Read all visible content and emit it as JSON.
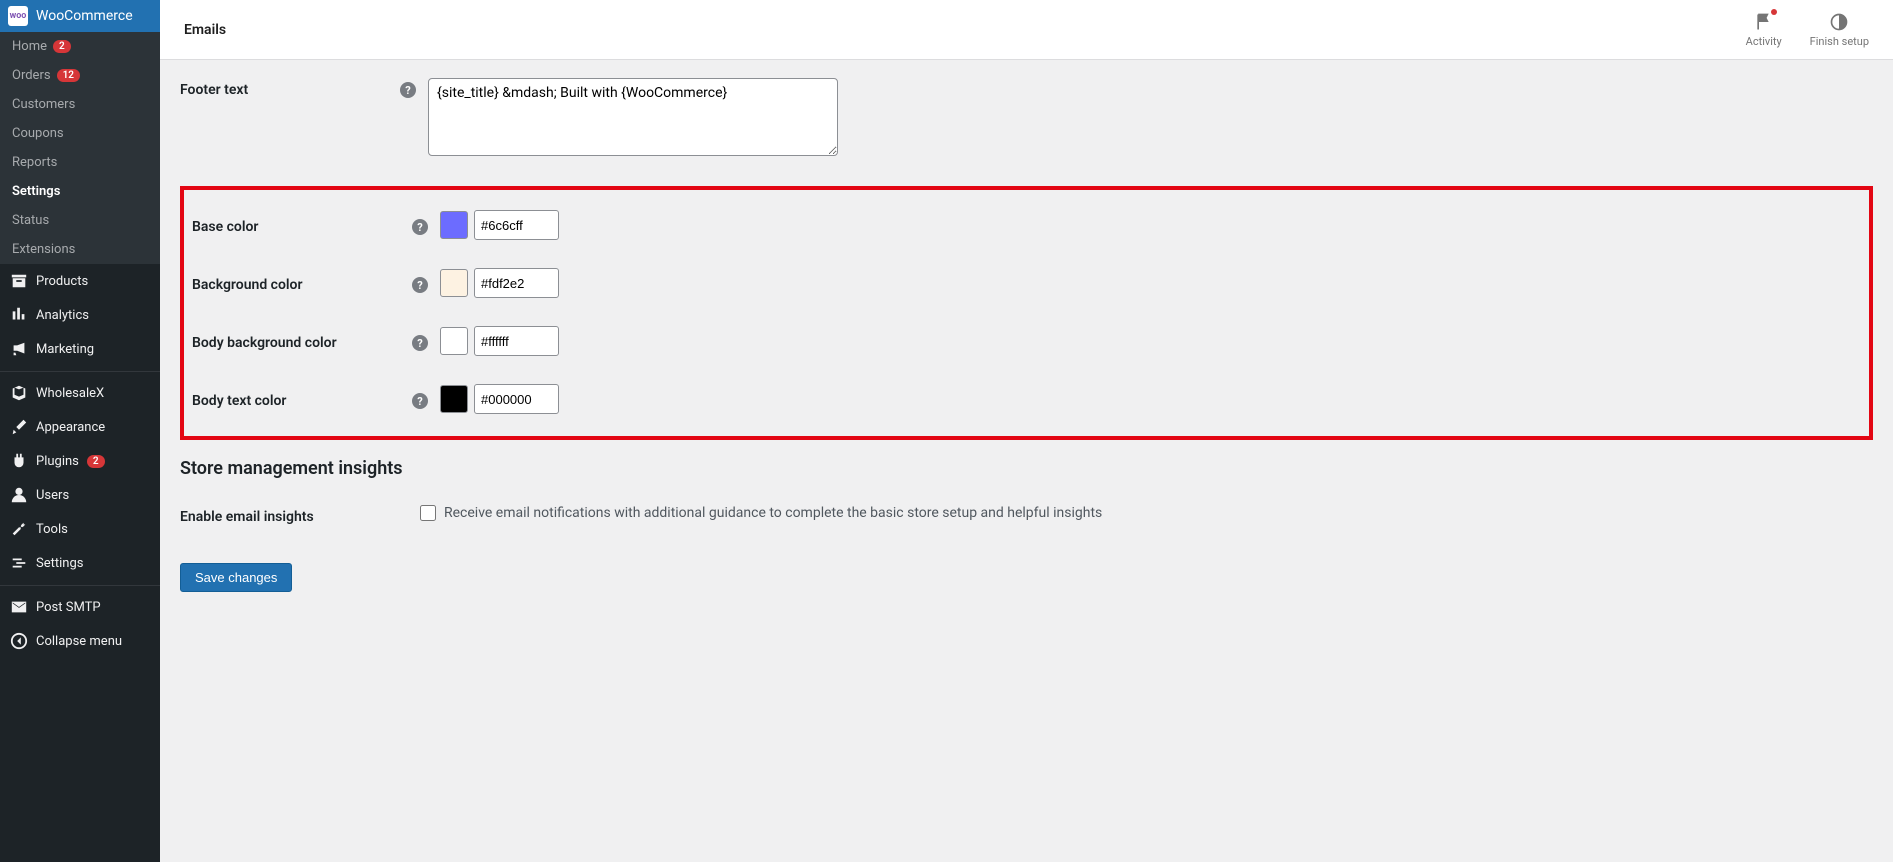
{
  "sidebar": {
    "brand_label": "WooCommerce",
    "items": {
      "home": {
        "label": "Home",
        "badge": "2"
      },
      "orders": {
        "label": "Orders",
        "badge": "12"
      },
      "customers": {
        "label": "Customers"
      },
      "coupons": {
        "label": "Coupons"
      },
      "reports": {
        "label": "Reports"
      },
      "settings": {
        "label": "Settings"
      },
      "status": {
        "label": "Status"
      },
      "extensions": {
        "label": "Extensions"
      }
    },
    "main": {
      "products": {
        "label": "Products"
      },
      "analytics": {
        "label": "Analytics"
      },
      "marketing": {
        "label": "Marketing"
      },
      "wholesalex": {
        "label": "WholesaleX"
      },
      "appearance": {
        "label": "Appearance"
      },
      "plugins": {
        "label": "Plugins",
        "badge": "2"
      },
      "users": {
        "label": "Users"
      },
      "tools": {
        "label": "Tools"
      },
      "settings_wp": {
        "label": "Settings"
      },
      "post_smtp": {
        "label": "Post SMTP"
      },
      "collapse": {
        "label": "Collapse menu"
      }
    }
  },
  "topbar": {
    "title": "Emails",
    "activity": "Activity",
    "finish": "Finish setup"
  },
  "form": {
    "footer_text": {
      "label": "Footer text",
      "value": "{site_title} &mdash; Built with {WooCommerce}"
    },
    "base_color": {
      "label": "Base color",
      "value": "#6c6cff",
      "swatch": "#6c6cff"
    },
    "bg_color": {
      "label": "Background color",
      "value": "#fdf2e2",
      "swatch": "#fdf2e2"
    },
    "body_bg": {
      "label": "Body background color",
      "value": "#ffffff",
      "swatch": "#ffffff"
    },
    "body_text": {
      "label": "Body text color",
      "value": "#000000",
      "swatch": "#000000"
    }
  },
  "insights": {
    "heading": "Store management insights",
    "enable_label": "Enable email insights",
    "checkbox_text": "Receive email notifications with additional guidance to complete the basic store setup and helpful insights"
  },
  "save_label": "Save changes"
}
